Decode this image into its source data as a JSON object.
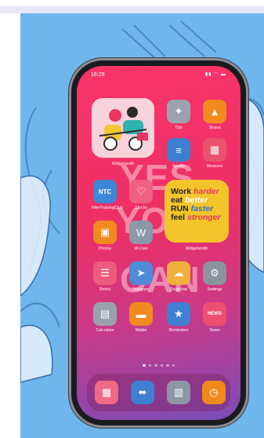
{
  "status": {
    "time": "16:29",
    "icons": "▮▮ ◠ ▬"
  },
  "background": {
    "line1": "YES",
    "line2": "YOU",
    "line3": "CAN"
  },
  "widgets": {
    "photo_label": "Widgetsmith",
    "quote_label": "Widgetsmith",
    "quote": {
      "l1a": "Work",
      "l1b": "harder",
      "l2a": "eat",
      "l2b": "better",
      "l3a": "RUN",
      "l3b": "faster",
      "l4a": "feel",
      "l4b": "stronger"
    }
  },
  "apps": [
    {
      "label": "Tips",
      "icon": "tips-icon",
      "glyph": "✦",
      "bg": "#9aa3ad"
    },
    {
      "label": "Strava",
      "icon": "strava-icon",
      "glyph": "▲",
      "bg": "#f28a1e"
    },
    {
      "label": "Spotify",
      "icon": "spotify-icon",
      "glyph": "≡",
      "bg": "#3d7fd1"
    },
    {
      "label": "Measure",
      "icon": "measure-icon",
      "glyph": "▦",
      "bg": "#e8546c"
    },
    {
      "label": "NikeTrainingClub",
      "icon": "ntc-icon",
      "glyph": "NTC",
      "bg": "#3e86d8"
    },
    {
      "label": "Stocks",
      "icon": "stocks-icon",
      "glyph": "♡",
      "bg": "#f06080"
    },
    {
      "label": "Photos",
      "icon": "photos-icon",
      "glyph": "▣",
      "bg": "#f08a1e"
    },
    {
      "label": "W-Cian",
      "icon": "wcian-icon",
      "glyph": "W",
      "bg": "#8a99a8"
    },
    {
      "label": "Drinks",
      "icon": "drinks-icon",
      "glyph": "☰",
      "bg": "#ef5b7c"
    },
    {
      "label": "Telegram",
      "icon": "telegram-icon",
      "glyph": "➤",
      "bg": "#4f8bd6"
    },
    {
      "label": "Snapchat",
      "icon": "snapchat-icon",
      "glyph": "☁",
      "bg": "#f0b03a"
    },
    {
      "label": "Settings",
      "icon": "settings-icon",
      "glyph": "⚙",
      "bg": "#8a939e"
    },
    {
      "label": "Calculator",
      "icon": "calculator-icon",
      "glyph": "▤",
      "bg": "#98a2ad"
    },
    {
      "label": "Wallet",
      "icon": "wallet-icon",
      "glyph": "▬",
      "bg": "#f08a1e"
    },
    {
      "label": "Reminders",
      "icon": "reminders-icon",
      "glyph": "★",
      "bg": "#3f80d2"
    },
    {
      "label": "News",
      "icon": "news-icon",
      "glyph": "NEWS",
      "bg": "#ee4f71"
    }
  ],
  "dock": [
    {
      "icon": "calendar-icon",
      "glyph": "▦",
      "bg": "#f06a86"
    },
    {
      "icon": "fitness-icon",
      "glyph": "⬌",
      "bg": "#3f7fd0"
    },
    {
      "icon": "basket-icon",
      "glyph": "▥",
      "bg": "#8d97a3"
    },
    {
      "icon": "timer-icon",
      "glyph": "◷",
      "bg": "#f08a1e"
    }
  ],
  "pages": {
    "count": 6,
    "current": 0
  },
  "colors": {
    "scene_bg": "#6fb6ec",
    "screen_top": "#f8356a",
    "quote_bg": "#f3c52b"
  }
}
